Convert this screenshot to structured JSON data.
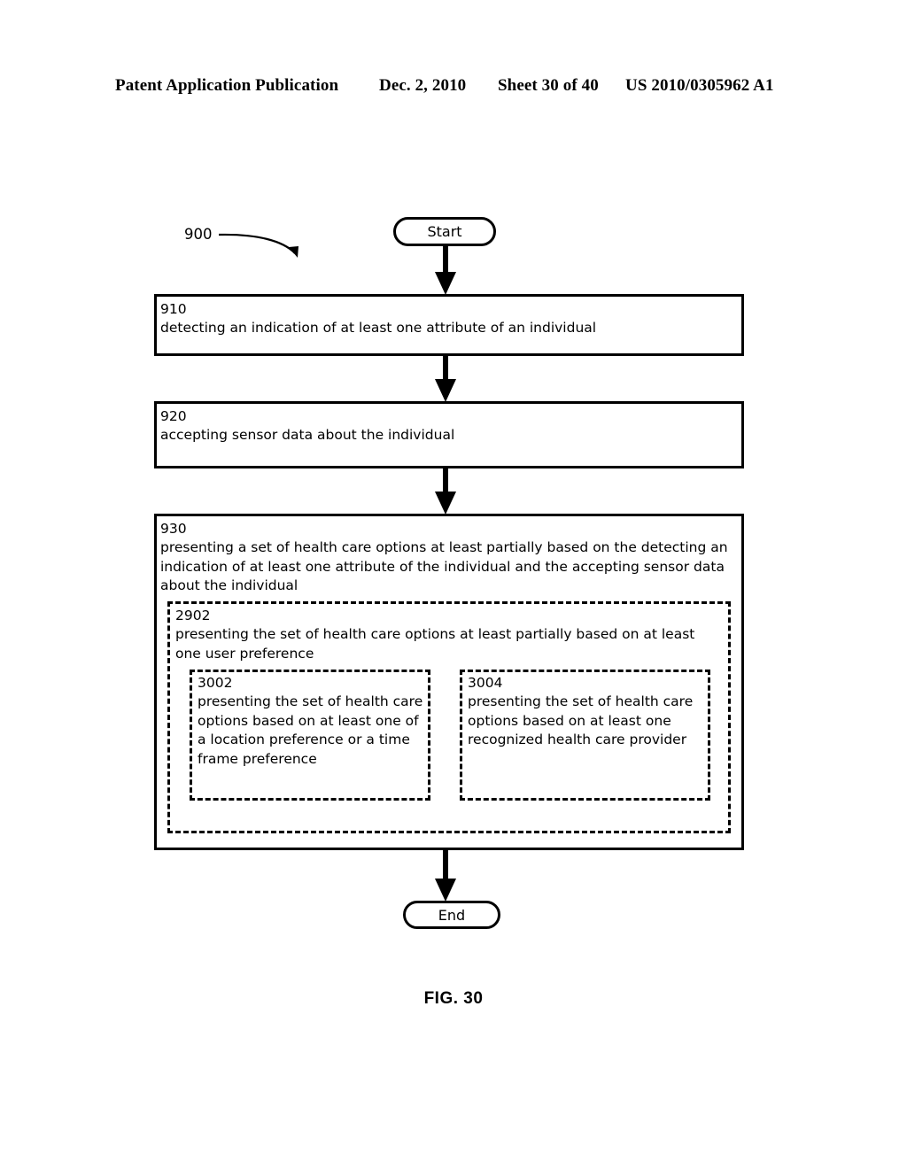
{
  "header": {
    "publication": "Patent Application Publication",
    "date": "Dec. 2, 2010",
    "sheet": "Sheet 30 of 40",
    "patent_number": "US 2010/0305962 A1"
  },
  "figure": {
    "caption": "FIG. 30",
    "reference_numeral": "900"
  },
  "flowchart": {
    "start_label": "Start",
    "end_label": "End",
    "steps": [
      {
        "number": "910",
        "text": "detecting an indication of at least one attribute of an individual"
      },
      {
        "number": "920",
        "text": "accepting sensor data about the individual"
      },
      {
        "number": "930",
        "text": "presenting a set of health care options at least partially based on the detecting an indication of at least one attribute of the individual and the accepting sensor data about the individual"
      }
    ],
    "substeps": [
      {
        "number": "2902",
        "text": "presenting the set of health care options at least partially based on at least one user preference"
      }
    ],
    "subsubsteps": [
      {
        "number": "3002",
        "text": "presenting the set of health care options based on at least one of a location preference or a time frame preference"
      },
      {
        "number": "3004",
        "text": "presenting the set of health care options based on at least one recognized health care provider"
      }
    ]
  },
  "colors": {
    "ink": "#000000",
    "page": "#ffffff"
  }
}
